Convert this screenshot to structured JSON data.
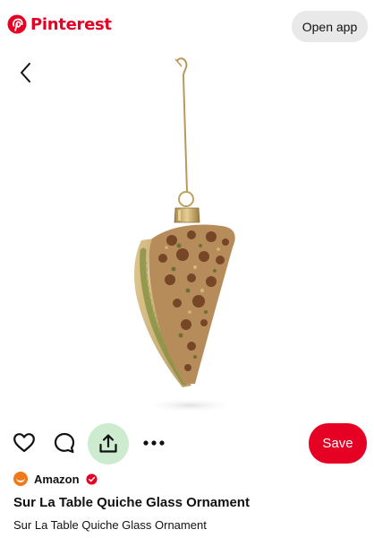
{
  "header": {
    "brand_name": "Pinterest",
    "brand_color": "#e60023",
    "open_app_label": "Open app"
  },
  "navigation": {
    "back_icon": "chevron-left-icon"
  },
  "pin": {
    "image_subject": "quiche-slice-glass-ornament",
    "visual_search_icon": "visual-search-icon"
  },
  "actions": {
    "like_icon": "heart-icon",
    "comment_icon": "comment-icon",
    "share_icon": "share-icon",
    "more_icon": "more-icon",
    "save_label": "Save",
    "save_color": "#e60023",
    "share_highlight_color": "#cdeccf"
  },
  "source": {
    "name": "Amazon",
    "verified": true
  },
  "title": "Sur La Table Quiche Glass Ornament",
  "description": "Sur La Table Quiche Glass Ornament"
}
